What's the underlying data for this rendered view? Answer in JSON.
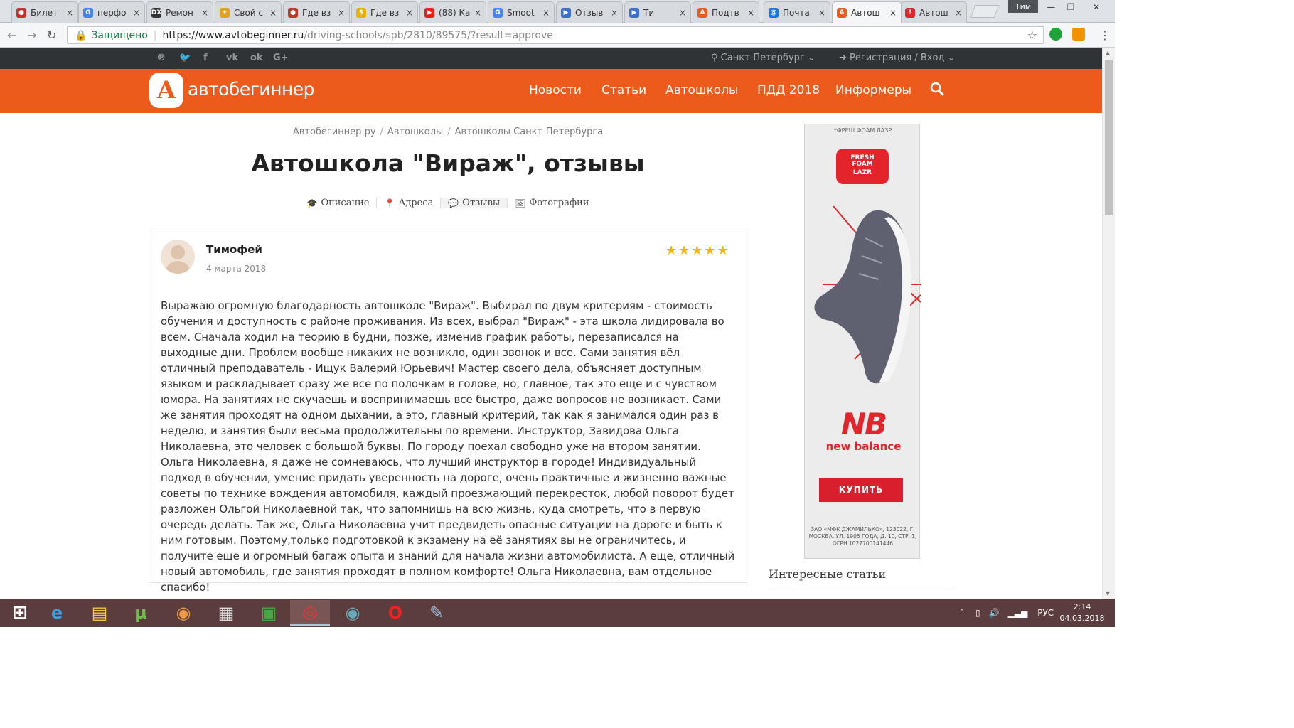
{
  "browser": {
    "tabs": [
      {
        "title": "Билет",
        "color": "#c9302c",
        "glyph": "●"
      },
      {
        "title": "перфо",
        "color": "#4285f4",
        "glyph": "G"
      },
      {
        "title": "Ремон",
        "color": "#333333",
        "glyph": "DX"
      },
      {
        "title": "Свой с",
        "color": "#e0a020",
        "glyph": "✦"
      },
      {
        "title": "Где вз",
        "color": "#c0392b",
        "glyph": "●"
      },
      {
        "title": "Где вз",
        "color": "#e8b000",
        "glyph": "$"
      },
      {
        "title": "(88) Ка",
        "color": "#e62117",
        "glyph": "▶"
      },
      {
        "title": "Smoot",
        "color": "#4285f4",
        "glyph": "G"
      },
      {
        "title": "Отзыв",
        "color": "#3b6fd1",
        "glyph": "▶"
      },
      {
        "title": "Ти",
        "color": "#3b6fd1",
        "glyph": "▶"
      },
      {
        "title": "Подтв",
        "color": "#ec5a1c",
        "glyph": "A"
      },
      {
        "title": "Почта",
        "color": "#1a73e8",
        "glyph": "@"
      },
      {
        "title": "Автош",
        "color": "#ec5a1c",
        "glyph": "A"
      },
      {
        "title": "Автош",
        "color": "#e3242b",
        "glyph": "!"
      }
    ],
    "user_label": "Тим",
    "secure_label": "Защищено",
    "url_scheme_host": "https://www.avtobeginner.ru",
    "url_path": "/driving-schools/spb/2810/89575/?result=approve"
  },
  "site": {
    "city": "Санкт-Петербург",
    "login": "Регистрация / Вход",
    "logo_letter": "А",
    "logo_text": "автобегиннер",
    "menu": [
      "Новости",
      "Статьи",
      "Автошколы",
      "ПДД 2018",
      "Информеры"
    ],
    "social": [
      "pinterest-icon",
      "twitter-icon",
      "facebook-icon",
      "vk-icon",
      "odnoklassniki-icon",
      "google-plus-icon"
    ],
    "social_glyphs": [
      "℗",
      "🐦",
      "f",
      "vk",
      "ok",
      "G+"
    ]
  },
  "page": {
    "breadcrumb": [
      "Автобегиннер.ру",
      "Автошколы",
      "Автошколы Санкт-Петербурга"
    ],
    "title": "Автошкола \"Вираж\", отзывы",
    "subnav": [
      {
        "label": "Описание",
        "icon": "graduation-cap-icon",
        "glyph": "🎓"
      },
      {
        "label": "Адреса",
        "icon": "map-marker-icon",
        "glyph": "📍"
      },
      {
        "label": "Отзывы",
        "icon": "comments-icon",
        "glyph": "💬"
      },
      {
        "label": "Фотографии",
        "icon": "picture-icon",
        "glyph": "🖼"
      }
    ]
  },
  "review": {
    "author": "Тимофей",
    "date": "4 марта 2018",
    "rating": 5,
    "text": "Выражаю огромную благодарность автошколе \"Вираж\". Выбирал по двум критериям - стоимость обучения и доступность с районе проживания. Из всех, выбрал \"Вираж\" - эта школа лидировала во всем. Сначала ходил на теорию в будни, позже, изменив график работы, перезаписался на выходные дни. Проблем вообще никаких не возникло, один звонок и все. Сами занятия вёл отличный преподаватель - Ищук Валерий Юрьевич! Мастер своего дела, объясняет доступным языком и раскладывает сразу же все по полочкам в голове, но, главное, так это еще и с чувством юмора. На занятиях не скучаешь и воспринимаешь все быстро, даже вопросов не возникает. Сами же занятия проходят на одном дыхании, а это, главный критерий, так как я занимался один раз в неделю, и занятия были весьма продолжительны по времени. Инструктор, Завидова Ольга Николаевна, это человек с большой буквы. По городу поехал свободно уже на втором занятии. Ольга Николаевна, я даже не сомневаюсь, что лучший инструктор в городе! Индивидуальный подход в обучении, умение придать уверенность на дороге, очень практичные и жизненно важные советы по технике вождения автомобиля, каждый проезжающий перекресток, любой поворот будет разложен Ольгой Николаевной так, что запомнишь на всю жизнь, куда смотреть, что в первую очередь делать. Так же, Ольга Николаевна учит предвидеть опасные ситуации на дороге и быть к ним готовым. Поэтому,только подготовкой к экзамену на её занятиях вы не ограничитесь, и получите еще и огромный багаж опыта и знаний для начала жизни автомобилиста. А еще, отличный новый автомобиль, где занятия проходят в полном комфорте! Ольга Николаевна, вам отдельное спасибо!"
  },
  "ad": {
    "top_text": "*ФРЕШ ФОАМ ЛАЗР",
    "badge_line1": "FRESH",
    "badge_line2": "FOAM",
    "badge_line3": "LAZR",
    "brand_mark": "NB",
    "brand": "new balance",
    "cta": "КУПИТЬ",
    "legal": "ЗАО «МФК ДЖАМИЛЬКО», 123022, Г. МОСКВА, УЛ. 1905 ГОДА, Д. 10, СТР. 1, ОГРН 1027700141446"
  },
  "sidebar": {
    "heading": "Интересные статьи"
  },
  "taskbar": {
    "apps": [
      "windows-start-icon",
      "internet-explorer-icon",
      "file-explorer-icon",
      "utorrent-icon",
      "picasa-icon",
      "notepad-icon",
      "store-icon",
      "chrome-icon",
      "browser-globe-icon",
      "opera-icon",
      "paint-icon"
    ],
    "lang": "РУС",
    "time": "2:14",
    "date": "04.03.2018"
  },
  "colors": {
    "brand_orange": "#ec5a1c",
    "dark_strip": "#2f3335",
    "star": "#f5b800",
    "ad_red": "#d91e2d"
  }
}
